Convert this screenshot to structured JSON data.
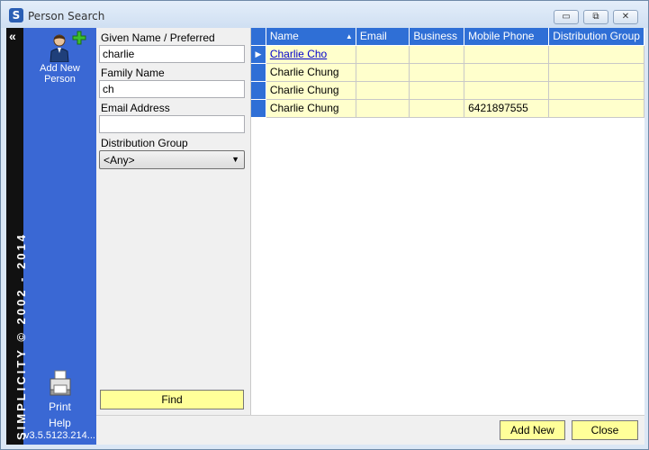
{
  "window": {
    "title": "Person Search",
    "app_icon": "S",
    "controls": {
      "minimize": "▭",
      "restore": "⧉",
      "close": "✕"
    }
  },
  "sidebar": {
    "collapse_glyph": "«",
    "copyright": "SIMPLICITY © 2002 - 2014",
    "add_person_label": "Add New Person",
    "print_label": "Print",
    "help_label": "Help",
    "version": "v3.5.5123.214..."
  },
  "search": {
    "given_name_label": "Given Name / Preferred",
    "given_name_value": "charlie",
    "family_name_label": "Family Name",
    "family_name_value": "ch",
    "email_label": "Email Address",
    "email_value": "",
    "group_label": "Distribution Group",
    "group_value": "<Any>",
    "find_label": "Find"
  },
  "grid": {
    "columns": [
      "Name",
      "Email",
      "Business",
      "Mobile Phone",
      "Distribution Group"
    ],
    "sort_glyph": "▲",
    "current_row_glyph": "▶",
    "rows": [
      {
        "name": "Charlie Cho",
        "email": "",
        "business": "",
        "mobile": "",
        "group": ""
      },
      {
        "name": "Charlie Chung",
        "email": "",
        "business": "",
        "mobile": "",
        "group": ""
      },
      {
        "name": "Charlie Chung",
        "email": "",
        "business": "",
        "mobile": "",
        "group": ""
      },
      {
        "name": "Charlie Chung",
        "email": "",
        "business": "",
        "mobile": "6421897555",
        "group": ""
      }
    ]
  },
  "footer": {
    "add_new_label": "Add New",
    "close_label": "Close"
  },
  "colors": {
    "sidebar_blue": "#3a68d4",
    "header_blue": "#2f6fd6",
    "row_yellow": "#ffffcc",
    "button_yellow": "#ffff99"
  }
}
